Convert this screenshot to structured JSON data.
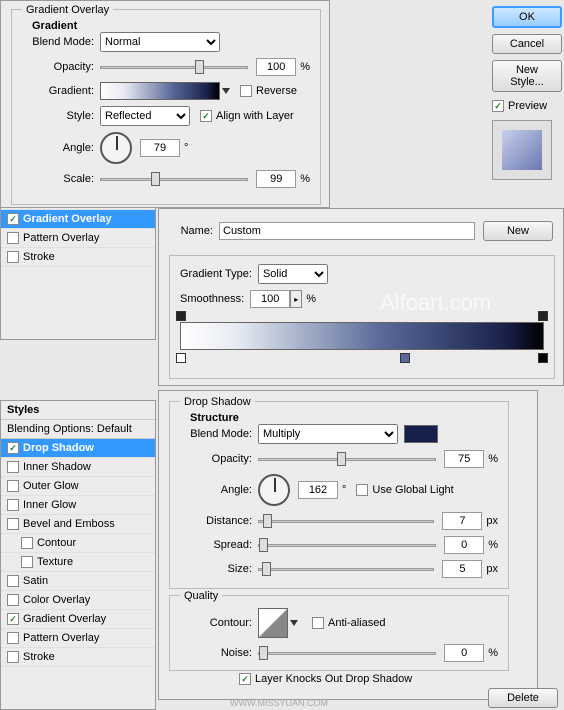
{
  "labels": {
    "styles": "Styles",
    "blending": "Blending Options: Default",
    "name": "Name:",
    "gradient_type": "Gradient Type:",
    "smoothness": "Smoothness:",
    "blend_mode": "Blend Mode:",
    "opacity": "Opacity:",
    "gradient": "Gradient:",
    "style": "Style:",
    "angle": "Angle:",
    "scale": "Scale:",
    "reverse": "Reverse",
    "align": "Align with Layer",
    "use_global": "Use Global Light",
    "distance": "Distance:",
    "spread": "Spread:",
    "size": "Size:",
    "contour": "Contour:",
    "anti": "Anti-aliased",
    "noise": "Noise:",
    "knockout": "Layer Knocks Out Drop Shadow",
    "deg": "°",
    "pct": "%",
    "px": "px",
    "preview": "Preview"
  },
  "buttons": {
    "ok": "OK",
    "cancel": "Cancel",
    "new_style": "New Style...",
    "new": "New",
    "delete": "Delete"
  },
  "style_items": [
    "Drop Shadow",
    "Inner Shadow",
    "Outer Glow",
    "Inner Glow",
    "Bevel and Emboss",
    "Contour",
    "Texture",
    "Satin",
    "Color Overlay",
    "Gradient Overlay",
    "Pattern Overlay",
    "Stroke"
  ],
  "panel1_checked": [
    true,
    false,
    false,
    false,
    false,
    false,
    false,
    false,
    false,
    true,
    false,
    false
  ],
  "panel1_selected": 9,
  "panel2_checked": [
    true,
    false,
    false,
    false,
    false,
    false,
    false,
    false,
    false,
    true,
    false,
    false
  ],
  "panel2_selected": 0,
  "gradient_overlay": {
    "title": "Gradient Overlay",
    "sub": "Gradient",
    "blend_mode": "Normal",
    "opacity": 100,
    "style": "Reflected",
    "align": true,
    "reverse": false,
    "angle": 79,
    "scale": 99
  },
  "grad_editor": {
    "name_value": "Custom",
    "type": "Solid",
    "smoothness": 100
  },
  "drop_shadow": {
    "title": "Drop Shadow",
    "structure": "Structure",
    "quality": "Quality",
    "blend_mode": "Multiply",
    "opacity": 75,
    "angle": 162,
    "use_global": false,
    "distance": 7,
    "spread": 0,
    "size": 5,
    "anti": false,
    "noise": 0,
    "knockout": true
  },
  "watermarks": {
    "w1": "Alfoart.com",
    "w2": "WWW.MISSYUAN.COM"
  }
}
